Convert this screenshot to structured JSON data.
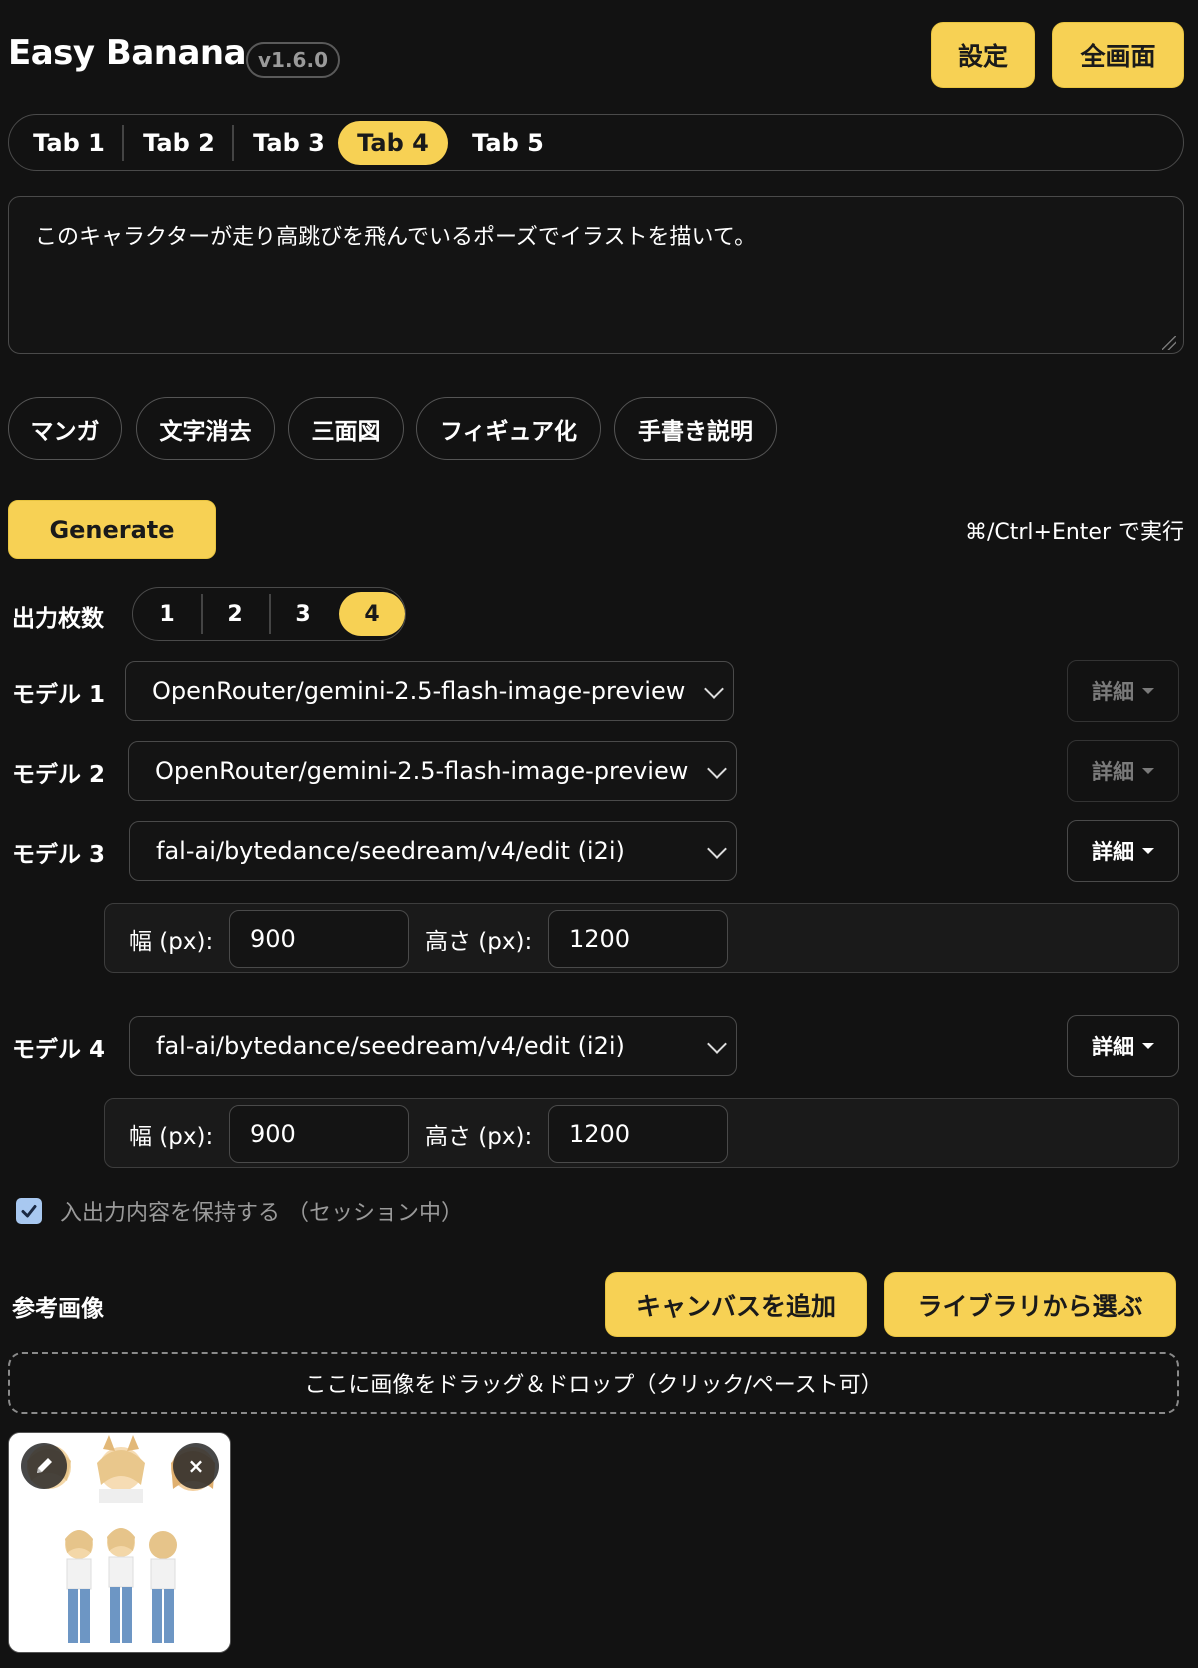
{
  "app": {
    "title": "Easy Banana",
    "version": "v1.6.0"
  },
  "header": {
    "settings_label": "設定",
    "fullscreen_label": "全画面"
  },
  "tabs": [
    {
      "label": "Tab 1",
      "active": false
    },
    {
      "label": "Tab 2",
      "active": false
    },
    {
      "label": "Tab 3",
      "active": false
    },
    {
      "label": "Tab 4",
      "active": true
    },
    {
      "label": "Tab 5",
      "active": false
    }
  ],
  "prompt": {
    "value": "このキャラクターが走り高跳びを飛んでいるポーズでイラストを描いて。"
  },
  "presets": [
    "マンガ",
    "文字消去",
    "三面図",
    "フィギュア化",
    "手書き説明"
  ],
  "generate": {
    "label": "Generate",
    "hint": "⌘/Ctrl+Enter で実行"
  },
  "output_count": {
    "label": "出力枚数",
    "options": [
      "1",
      "2",
      "3",
      "4"
    ],
    "selected": "4"
  },
  "models": [
    {
      "label": "モデル 1",
      "value": "OpenRouter/gemini-2.5-flash-image-preview",
      "detail_label": "詳細",
      "expanded": false
    },
    {
      "label": "モデル 2",
      "value": "OpenRouter/gemini-2.5-flash-image-preview",
      "detail_label": "詳細",
      "expanded": false
    },
    {
      "label": "モデル 3",
      "value": "fal-ai/bytedance/seedream/v4/edit (i2i)",
      "detail_label": "詳細",
      "expanded": true,
      "width_label": "幅 (px):",
      "width": "900",
      "height_label": "高さ (px):",
      "height": "1200"
    },
    {
      "label": "モデル 4",
      "value": "fal-ai/bytedance/seedream/v4/edit (i2i)",
      "detail_label": "詳細",
      "expanded": true,
      "width_label": "幅 (px):",
      "width": "900",
      "height_label": "高さ (px):",
      "height": "1200"
    }
  ],
  "keep_io": {
    "label": "入出力内容を保持する （セッション中）",
    "checked": true
  },
  "reference": {
    "label": "参考画像",
    "add_canvas_label": "キャンバスを追加",
    "library_label": "ライブラリから選ぶ",
    "dropzone_text": "ここに画像をドラッグ＆ドロップ（クリック/ペースト可）",
    "remove_glyph": "×"
  },
  "colors": {
    "accent": "#f7d154",
    "background": "#121212",
    "border": "#4a4a4a"
  }
}
